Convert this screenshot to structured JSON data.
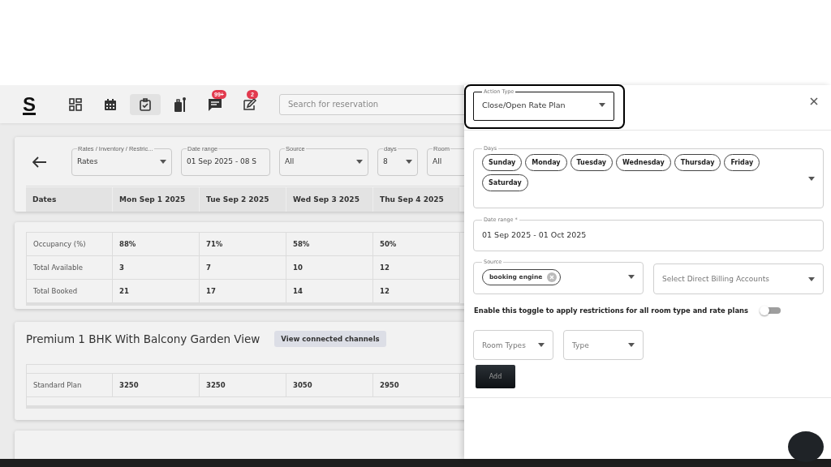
{
  "header": {
    "logo": "S",
    "nav": [
      {
        "kind": "dashboard",
        "selected": false
      },
      {
        "kind": "calendar",
        "selected": false
      },
      {
        "kind": "tasks",
        "selected": true
      },
      {
        "kind": "luggage",
        "selected": false
      },
      {
        "kind": "chat",
        "selected": false,
        "badge": "99+"
      },
      {
        "kind": "edit",
        "selected": false,
        "badge": "2"
      }
    ],
    "search": {
      "placeholder": "Search for reservation"
    }
  },
  "filters": [
    {
      "label": "Rates / Inventory / Restric...",
      "value": "Rates",
      "dropdown": true
    },
    {
      "label": "Date range",
      "value": "01 Sep 2025 - 08 S",
      "dropdown": false
    },
    {
      "label": "Source",
      "value": "All",
      "dropdown": true
    },
    {
      "label": "days",
      "value": "8",
      "dropdown": true
    },
    {
      "label": "Room",
      "value": "All"
    }
  ],
  "columns": [
    "Dates",
    "Mon Sep 1 2025",
    "Tue Sep 2 2025",
    "Wed Sep 3 2025",
    "Thu Sep 4 2025"
  ],
  "summary_rows": [
    {
      "label": "Occupancy (%)",
      "values": [
        "88%",
        "71%",
        "58%",
        "50%"
      ]
    },
    {
      "label": "Total Available",
      "values": [
        "3",
        "7",
        "10",
        "12"
      ]
    },
    {
      "label": "Total Booked",
      "values": [
        "21",
        "17",
        "14",
        "12"
      ]
    }
  ],
  "room_sections": [
    {
      "title": "Premium 1 BHK With Balcony Garden View",
      "button": "View connected channels",
      "rows": [
        {
          "label": "Standard Plan",
          "values": [
            "3250",
            "3250",
            "3050",
            "2950"
          ]
        }
      ]
    }
  ],
  "drawer": {
    "action_type": {
      "label": "Action Type",
      "value": "Close/Open Rate Plan"
    },
    "days": {
      "label": "Days",
      "chips": [
        "Sunday",
        "Monday",
        "Tuesday",
        "Wednesday",
        "Thursday",
        "Friday",
        "Saturday"
      ]
    },
    "date_range": {
      "label": "Date range *",
      "value": "01 Sep 2025 - 01 Oct 2025"
    },
    "source": {
      "label": "Source",
      "chips": [
        "booking engine"
      ]
    },
    "billing": {
      "placeholder": "Select Direct Billing Accounts"
    },
    "toggle": {
      "label": "Enable this toggle to apply restrictions for all room type and rate plans",
      "on": false
    },
    "room_types": {
      "placeholder": "Room Types"
    },
    "type": {
      "placeholder": "Type"
    },
    "add_button": "Add"
  }
}
